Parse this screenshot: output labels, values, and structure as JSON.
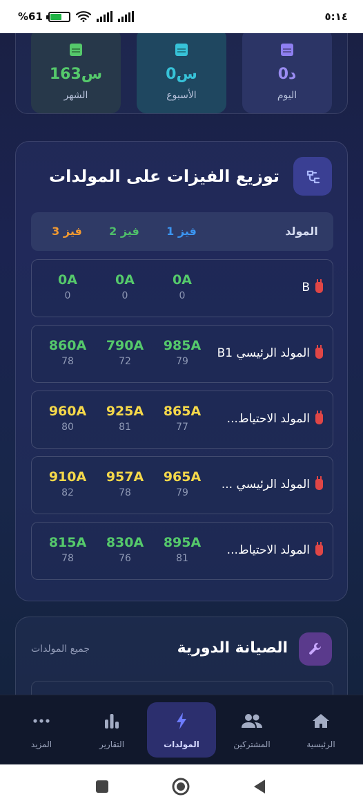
{
  "status_bar": {
    "time": "٥:١٤",
    "battery": "%61",
    "battery_level": 0.61
  },
  "stats": [
    {
      "value": "0د",
      "label": "اليوم",
      "color": "#9a8cf2"
    },
    {
      "value": "0س",
      "label": "الأسبوع",
      "color": "#37c2d8"
    },
    {
      "value": "163س",
      "label": "الشهر",
      "color": "#55c96b"
    }
  ],
  "phases": {
    "icon": "plug-icon",
    "title": "توزيع الفيزات على المولدات",
    "headers": {
      "generator": "المولد",
      "p1": "فيز 1",
      "p2": "فيز 2",
      "p3": "فيز 3"
    },
    "colors": {
      "p1": "#3b95f2",
      "p2": "#4fbf6a",
      "p3": "#f39a30",
      "green": "#55c96b",
      "yellow": "#f5d84a"
    },
    "rows": [
      {
        "name": "B",
        "p1": "0A",
        "p1n": "0",
        "p2": "0A",
        "p2n": "0",
        "p3": "0A",
        "p3n": "0",
        "tone": "green"
      },
      {
        "name": "المولد الرئيسي B1",
        "p1": "985A",
        "p1n": "79",
        "p2": "790A",
        "p2n": "72",
        "p3": "860A",
        "p3n": "78",
        "tone": "green"
      },
      {
        "name": "المولد الاحتياط...",
        "p1": "865A",
        "p1n": "77",
        "p2": "925A",
        "p2n": "81",
        "p3": "960A",
        "p3n": "80",
        "tone": "yellow"
      },
      {
        "name": "المولد الرئيسي ...",
        "p1": "965A",
        "p1n": "79",
        "p2": "957A",
        "p2n": "78",
        "p3": "910A",
        "p3n": "82",
        "tone": "yellow"
      },
      {
        "name": "المولد الاحتياط...",
        "p1": "895A",
        "p1n": "81",
        "p2": "830A",
        "p2n": "76",
        "p3": "815A",
        "p3n": "78",
        "tone": "green"
      }
    ]
  },
  "maintenance": {
    "title": "الصيانة الدورية",
    "filter": "جميع المولدات",
    "icon": "wrench-icon"
  },
  "nav": {
    "items": [
      {
        "label": "الرئيسية",
        "icon": "home-icon"
      },
      {
        "label": "المشتركين",
        "icon": "users-icon"
      },
      {
        "label": "المولدات",
        "icon": "bolt-icon",
        "active": true
      },
      {
        "label": "التقارير",
        "icon": "chart-icon"
      },
      {
        "label": "المزيد",
        "icon": "more-icon"
      }
    ]
  }
}
